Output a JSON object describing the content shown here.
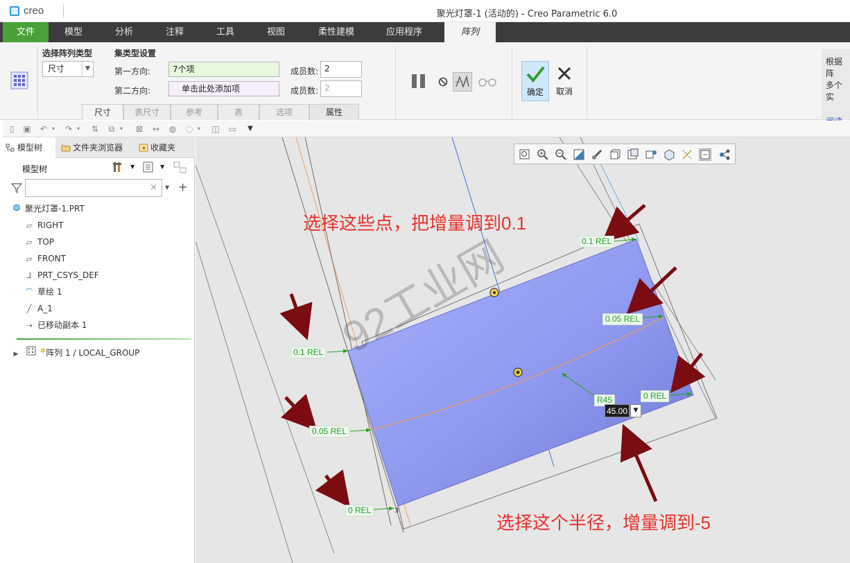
{
  "app": {
    "logo_text": "creo",
    "window_title": "聚光灯罩-1 (活动的) - Creo Parametric 6.0"
  },
  "ribbon_tabs": [
    "文件",
    "模型",
    "分析",
    "注释",
    "工具",
    "视图",
    "柔性建模",
    "应用程序",
    "阵列"
  ],
  "ribbon": {
    "pattern_type_label": "选择阵列类型",
    "pattern_type_value": "尺寸",
    "set_type_label": "集类型设置",
    "dir1_label": "第一方向:",
    "dir1_value": "7个项",
    "dir2_label": "第二方向:",
    "dir2_value": "单击此处添加项",
    "members_label_1": "成员数:",
    "members_value_1": "2",
    "members_label_2": "成员数:",
    "members_value_2": "2",
    "subtabs": [
      "尺寸",
      "表尺寸",
      "参考",
      "表",
      "选项",
      "属性"
    ],
    "ok_label": "确定",
    "cancel_label": "取消",
    "help_text_1": "根据阵",
    "help_text_2": "多个实",
    "help_link": "阅读更"
  },
  "left_panel": {
    "tabs": [
      "模型树",
      "文件夹浏览器",
      "收藏夹"
    ],
    "tree_title": "模型树",
    "filter_placeholder": "",
    "items": [
      {
        "label": "聚光灯罩-1.PRT",
        "icon": "part-icon"
      },
      {
        "label": "RIGHT",
        "icon": "datum-plane-icon"
      },
      {
        "label": "TOP",
        "icon": "datum-plane-icon"
      },
      {
        "label": "FRONT",
        "icon": "datum-plane-icon"
      },
      {
        "label": "PRT_CSYS_DEF",
        "icon": "csys-icon"
      },
      {
        "label": "草绘 1",
        "icon": "sketch-icon"
      },
      {
        "label": "A_1",
        "icon": "axis-icon"
      },
      {
        "label": "已移动副本 1",
        "icon": "moved-copy-icon"
      }
    ],
    "pattern_item": "阵列 1 / LOCAL_GROUP"
  },
  "canvas": {
    "dims": {
      "top_right": "0.1 REL",
      "mid_right": "0.05 REL",
      "left_top": "0.1 REL",
      "right_bottom": "0 REL",
      "radius": "R45",
      "left_mid": "0.05 REL",
      "left_bottom": "0 REL"
    },
    "dim_edit_value": "45.00",
    "annotation_1": "选择这些点，把增量调到0.1",
    "annotation_2": "选择这个半径，增量调到-5",
    "watermark": "92工业网",
    "small_mark": "3"
  },
  "colors": {
    "file_tab": "#4aa13a",
    "annotation": "#e8322f",
    "dim_text": "#22a322",
    "surface": "#8e98ee",
    "arrow": "#7a0c12"
  }
}
